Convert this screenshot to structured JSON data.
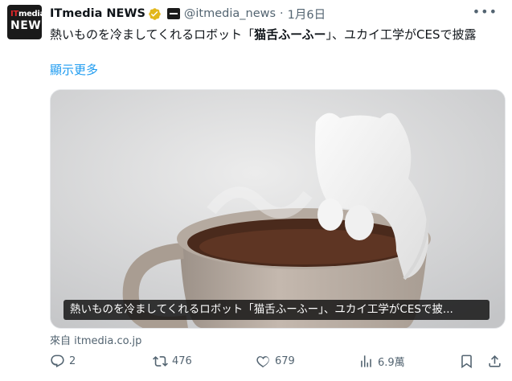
{
  "account": {
    "avatar_line1_accent": "IT",
    "avatar_line1": "media",
    "avatar_line2": "NEWS",
    "name": "ITmedia NEWS",
    "handle": "@itmedia_news",
    "separator": "·",
    "date": "1月6日"
  },
  "tweet": {
    "text_before": "熱いものを冷ましてくれるロボット「",
    "text_bold": "猫舌ふーふー",
    "text_after": "」、ユカイ工学がCESで披露",
    "show_translation": "顯示更多"
  },
  "media": {
    "caption": "熱いものを冷ましてくれるロボット「猫舌ふーふー」、ユカイ工学がCESで披..."
  },
  "source": "來自 itmedia.co.jp",
  "actions": {
    "reply": {
      "icon": "reply-icon",
      "count": "2"
    },
    "retweet": {
      "icon": "retweet-icon",
      "count": "476"
    },
    "like": {
      "icon": "heart-icon",
      "count": "679"
    },
    "views": {
      "icon": "views-icon",
      "count": "6.9萬"
    },
    "bookmark": {
      "icon": "bookmark-icon"
    },
    "share": {
      "icon": "share-icon"
    }
  },
  "colors": {
    "link": "#1d9bf0",
    "muted": "#536471",
    "verified": "#e2b719"
  }
}
